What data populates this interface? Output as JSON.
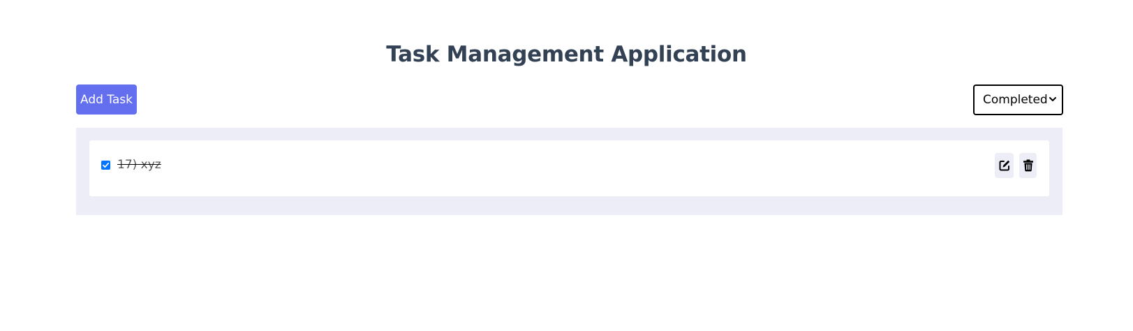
{
  "header": {
    "title": "Task Management Application"
  },
  "toolbar": {
    "add_task_label": "Add Task",
    "filter_selected": "Completed"
  },
  "tasks": [
    {
      "text": "17) xyz",
      "completed": true,
      "icons": {
        "edit": "edit-icon",
        "delete": "trash-icon"
      }
    }
  ],
  "colors": {
    "primary_button": "#646ff0",
    "title": "#334155",
    "panel_background": "#ecedf6",
    "checkbox": "#0075ff"
  }
}
